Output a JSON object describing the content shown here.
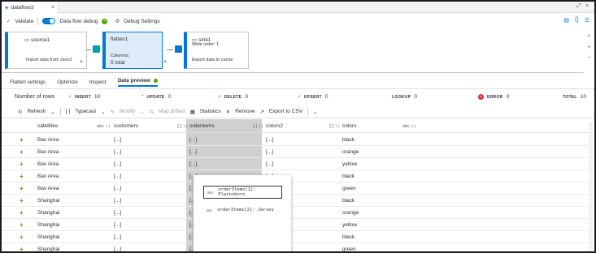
{
  "tab": {
    "title": "dataflow3",
    "close": "×"
  },
  "window_controls": {
    "expand": "⤢",
    "close": "×"
  },
  "toolbar": {
    "validate": "Validate",
    "dataflow_debug": "Data flow debug",
    "debug_settings": "Debug Settings",
    "icons": [
      "code-icon",
      "braces-icon",
      "properties-icon"
    ]
  },
  "canvas": {
    "source": {
      "title": "source1",
      "desc": "Import data from Json2"
    },
    "flatten": {
      "title": "flatten1",
      "columns_label": "Columns:",
      "columns_value": "5 total"
    },
    "sink": {
      "title": "sink1",
      "order": "Write order: 1",
      "desc": "Export data to cache"
    },
    "plus": "+"
  },
  "panel_tabs": [
    "Flatten settings",
    "Optimize",
    "Inspect",
    "Data preview"
  ],
  "stats": {
    "rows_label": "Number of rows",
    "insert": {
      "label": "INSERT",
      "value": "10"
    },
    "update": {
      "label": "UPDATE",
      "value": "0"
    },
    "delete": {
      "label": "DELETE",
      "value": "0"
    },
    "upsert": {
      "label": "UPSERT",
      "value": "0"
    },
    "lookup": {
      "label": "LOOKUP",
      "value": "0"
    },
    "error": {
      "label": "ERROR",
      "value": "0"
    },
    "total": {
      "label": "TOTAL",
      "value": "10"
    }
  },
  "actions": {
    "refresh": "Refresh",
    "typecast": "Typecast",
    "modify": "Modify",
    "map_drifted": "Map drifted",
    "statistics": "Statistics",
    "remove": "Remove",
    "export": "Export to CSV"
  },
  "columns": [
    {
      "name": "satellites",
      "meta": "abc"
    },
    {
      "name": "customers",
      "meta": "[ ]"
    },
    {
      "name": "orderitems",
      "meta": "[ ]"
    },
    {
      "name": "colors2",
      "meta": "[ ]"
    },
    {
      "name": "colors",
      "meta": "abc"
    }
  ],
  "rows": [
    [
      "+",
      "Bav Area",
      "[...]",
      "[...]",
      "[...]",
      "black"
    ],
    [
      "+",
      "Bav Area",
      "[...]",
      "[...]",
      "[...]",
      "orange"
    ],
    [
      "+",
      "Bav Area",
      "[...]",
      "[...]",
      "[...]",
      "yellow"
    ],
    [
      "+",
      "Bav Area",
      "[...]",
      "[...]",
      "[...]",
      "black"
    ],
    [
      "+",
      "Bav Area",
      "[...]",
      "[...]",
      "[...]",
      "green"
    ],
    [
      "+",
      "Shanghai",
      "[...]",
      "[...]",
      "[...]",
      "black"
    ],
    [
      "+",
      "Shanghai",
      "[...]",
      "[...]",
      "[...]",
      "orange"
    ],
    [
      "+",
      "Shanghai",
      "[...]",
      "[...]",
      "[...]",
      "yellow"
    ],
    [
      "+",
      "Shanghai",
      "[...]",
      "[...]",
      "[...]",
      "black"
    ],
    [
      "+",
      "Shanghai",
      "[...]",
      "[...]",
      "[...]",
      "green"
    ]
  ],
  "popup": {
    "items": [
      {
        "type": "abc",
        "text": "orderItems[1]: Plainsboro"
      },
      {
        "type": "abc",
        "text": "orderItems[2]: Jersey"
      }
    ]
  },
  "colors": {
    "accent": "#0078d4",
    "success": "#57a300",
    "error": "#d13438"
  }
}
